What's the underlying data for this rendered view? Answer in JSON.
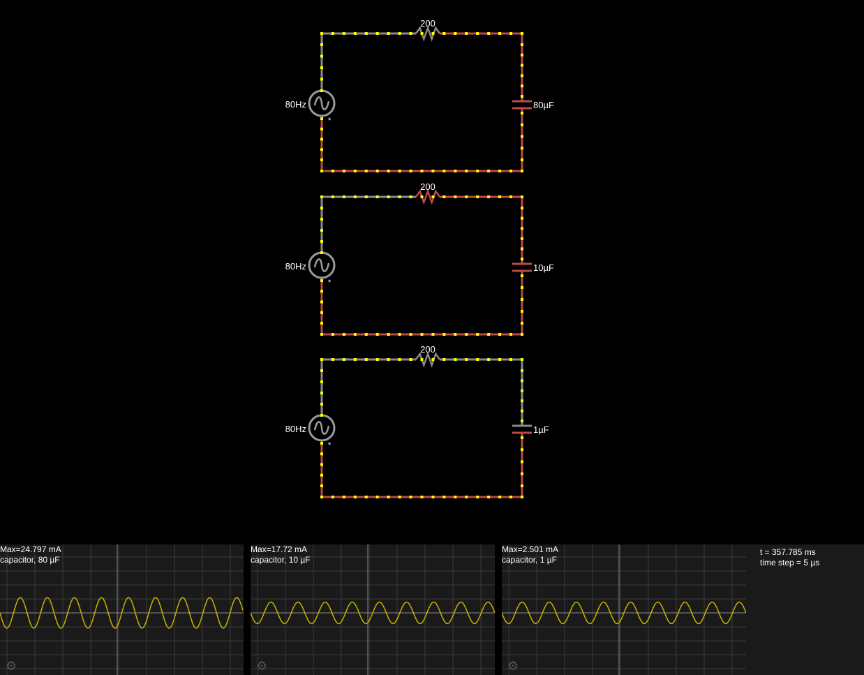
{
  "colors": {
    "background": "#000000",
    "wire_positive": "#c04848",
    "wire_neutral": "#8a8a8a",
    "current_dot": "#ffff00",
    "source_ring": "#9a9a9a",
    "scope_background": "#1a1a1a",
    "scope_trace": "#c8b400",
    "scope_grid": "#3a3a3a"
  },
  "circuits": [
    {
      "resistor_label": "200",
      "source_label": "80Hz",
      "capacitor_label": "80µF",
      "source_marker": "*"
    },
    {
      "resistor_label": "200",
      "source_label": "80Hz",
      "capacitor_label": "10µF",
      "source_marker": "*"
    },
    {
      "resistor_label": "200",
      "source_label": "80Hz",
      "capacitor_label": "1µF",
      "source_marker": "*"
    }
  ],
  "scopes": [
    {
      "max": "Max=24.797 mA",
      "name": "capacitor, 80 µF",
      "amplitude": 0.85,
      "cycles": 9
    },
    {
      "max": "Max=17.72 mA",
      "name": "capacitor, 10 µF",
      "amplitude": 0.6,
      "cycles": 9
    },
    {
      "max": "Max=2.501 mA",
      "name": "capacitor, 1 µF",
      "amplitude": 0.6,
      "cycles": 9
    }
  ],
  "info": {
    "time": "t = 357.785 ms",
    "time_step": "time step = 5 µs"
  },
  "icons": {
    "scope_settings": "gear-icon",
    "ac_source": "sine-wave-icon"
  }
}
